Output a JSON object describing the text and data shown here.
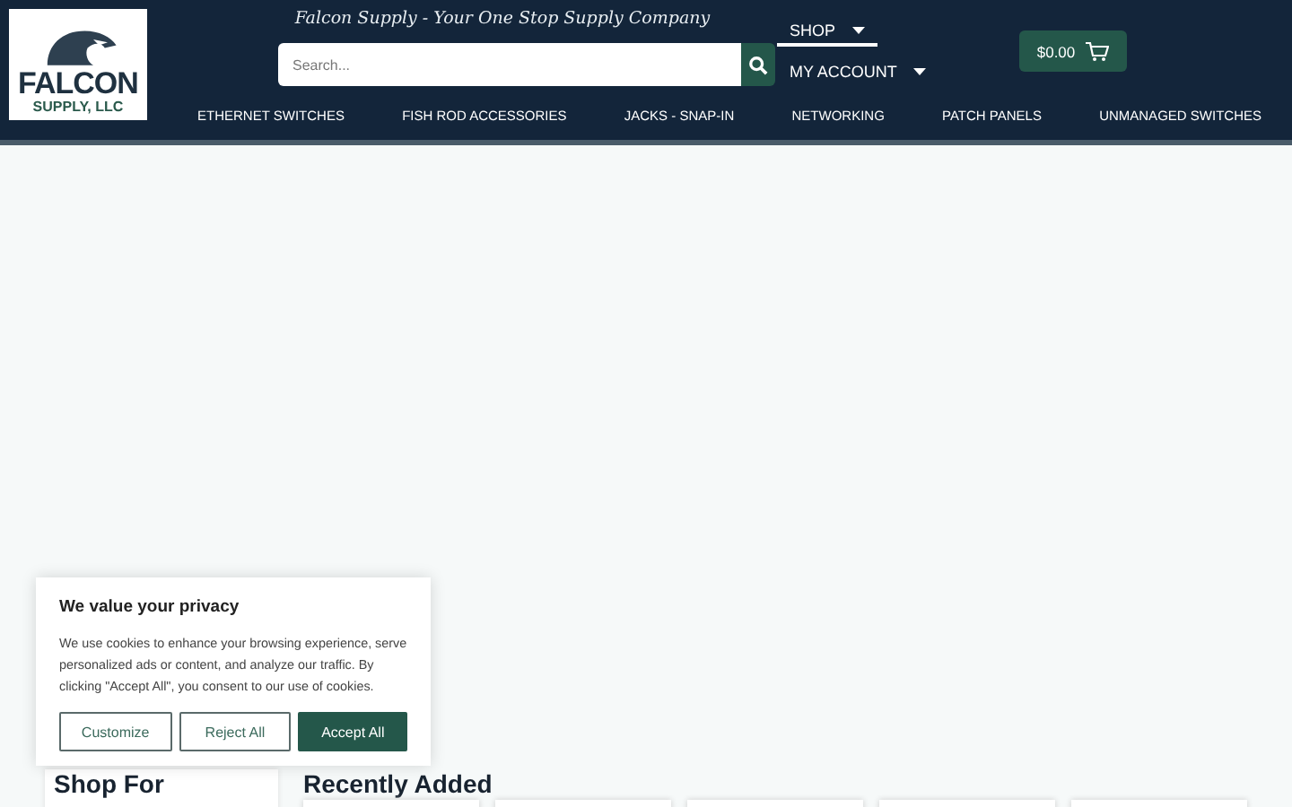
{
  "header": {
    "logo": {
      "name": "FALCON",
      "sub": "SUPPLY, LLC"
    },
    "tagline": "Falcon Supply - Your One Stop Supply Company",
    "search": {
      "placeholder": "Search..."
    },
    "menu": [
      {
        "label": "SHOP",
        "selected": true
      },
      {
        "label": "MY ACCOUNT",
        "selected": false
      }
    ],
    "cart": {
      "total": "$0.00"
    }
  },
  "nav": [
    "ETHERNET SWITCHES",
    "FISH ROD ACCESSORIES",
    "JACKS - SNAP-IN",
    "NETWORKING",
    "PATCH PANELS",
    "UNMANAGED SWITCHES"
  ],
  "sidebar": {
    "title": "Shop For"
  },
  "recent": {
    "title": "Recently Added"
  },
  "cookie_dialog": {
    "title": "We value your privacy",
    "text": "We use cookies to enhance your browsing experience, serve personalized ads or content, and analyze our traffic. By clicking \"Accept All\", you consent to our use of cookies.",
    "buttons": [
      {
        "label": "Customize",
        "kind": "outline"
      },
      {
        "label": "Reject All",
        "kind": "outline"
      },
      {
        "label": "Accept All",
        "kind": "primary"
      }
    ]
  }
}
